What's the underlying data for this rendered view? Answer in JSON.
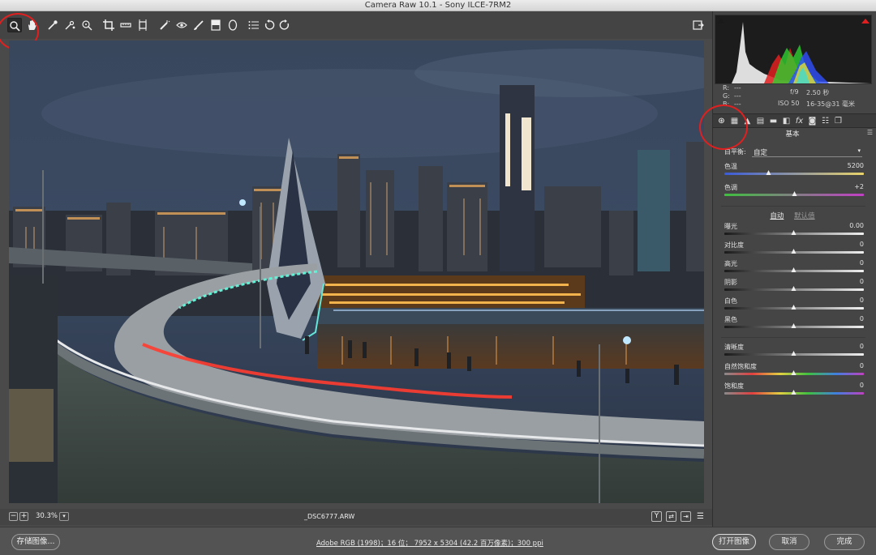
{
  "window": {
    "title": "Camera Raw 10.1 -  Sony ILCE-7RM2"
  },
  "tools": [
    {
      "id": "zoom",
      "icon": "zoom-icon"
    },
    {
      "id": "hand",
      "icon": "hand-icon"
    },
    {
      "id": "white-balance",
      "icon": "eyedropper-icon"
    },
    {
      "id": "color-sampler",
      "icon": "color-sampler-icon"
    },
    {
      "id": "targeted-adjust",
      "icon": "targeted-adjustment-icon"
    },
    {
      "id": "crop",
      "icon": "crop-icon"
    },
    {
      "id": "straighten",
      "icon": "straighten-icon"
    },
    {
      "id": "transform",
      "icon": "transform-icon"
    },
    {
      "id": "spot-removal",
      "icon": "spot-removal-icon"
    },
    {
      "id": "red-eye",
      "icon": "red-eye-icon"
    },
    {
      "id": "adjustment-brush",
      "icon": "adjustment-brush-icon"
    },
    {
      "id": "graduated-filter",
      "icon": "graduated-filter-icon"
    },
    {
      "id": "radial-filter",
      "icon": "radial-filter-icon"
    },
    {
      "id": "preferences",
      "icon": "list-icon"
    },
    {
      "id": "rotate-ccw",
      "icon": "rotate-ccw-icon"
    },
    {
      "id": "rotate-cw",
      "icon": "rotate-cw-icon"
    }
  ],
  "status": {
    "zoom": "30.3%",
    "filename": "_DSC6777.ARW"
  },
  "footer": {
    "save_label": "存储图像...",
    "workflow": "Adobe RGB (1998)；16 位；  7952 x 5304 (42.2 百万像素)；300 ppi",
    "open_label": "打开图像",
    "cancel_label": "取消",
    "done_label": "完成"
  },
  "readout": {
    "r_label": "R:",
    "r_value": "---",
    "g_label": "G:",
    "g_value": "---",
    "b_label": "B:",
    "b_value": "---",
    "aperture": "f/9",
    "shutter": "2.50 秒",
    "iso": "ISO 50",
    "lens": "16-35@31 毫米"
  },
  "panel": {
    "title": "基本",
    "wb_label": "白平衡:",
    "wb_value": "自定",
    "auto_label": "自动",
    "default_label": "默认值"
  },
  "sliders": [
    {
      "label": "色温",
      "value": "5200",
      "fraction": 0.32,
      "track": "temp"
    },
    {
      "label": "色调",
      "value": "+2",
      "fraction": 0.505,
      "track": "tint"
    },
    {
      "label": "曝光",
      "value": "0.00",
      "fraction": 0.5,
      "track": "gray"
    },
    {
      "label": "对比度",
      "value": "0",
      "fraction": 0.5,
      "track": "gray"
    },
    {
      "label": "高光",
      "value": "0",
      "fraction": 0.5,
      "track": "gray"
    },
    {
      "label": "阴影",
      "value": "0",
      "fraction": 0.5,
      "track": "gray"
    },
    {
      "label": "白色",
      "value": "0",
      "fraction": 0.5,
      "track": "gray"
    },
    {
      "label": "黑色",
      "value": "0",
      "fraction": 0.5,
      "track": "gray"
    },
    {
      "label": "清晰度",
      "value": "0",
      "fraction": 0.5,
      "track": "gray"
    },
    {
      "label": "自然饱和度",
      "value": "0",
      "fraction": 0.5,
      "track": "sat"
    },
    {
      "label": "饱和度",
      "value": "0",
      "fraction": 0.5,
      "track": "sat"
    }
  ],
  "colors": {
    "annotation": "#e02020",
    "temp_start": "#3a5bd8",
    "temp_end": "#e8d36a",
    "tint_start": "#3fbf3f",
    "tint_end": "#c23fc6"
  }
}
